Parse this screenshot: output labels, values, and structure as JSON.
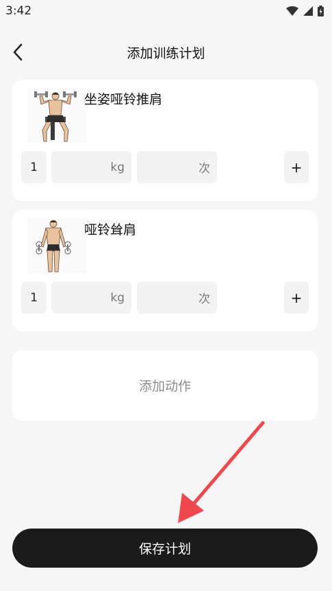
{
  "status_bar": {
    "time": "3:42",
    "icons": [
      "wifi-icon",
      "signal-icon",
      "battery-icon"
    ]
  },
  "header": {
    "title": "添加训练计划",
    "back_icon": "chevron-left-icon"
  },
  "exercises": [
    {
      "name": "坐姿哑铃推肩",
      "image": "seated-dumbbell-press-illustration",
      "set_number": "1",
      "weight_unit": "kg",
      "reps_unit": "次",
      "add_label": "+"
    },
    {
      "name": "哑铃耸肩",
      "image": "dumbbell-shrug-illustration",
      "set_number": "1",
      "weight_unit": "kg",
      "reps_unit": "次",
      "add_label": "+"
    }
  ],
  "add_exercise_label": "添加动作",
  "save_button_label": "保存计划",
  "annotation": {
    "arrow_color": "#f0474f"
  },
  "colors": {
    "background": "#f6f6f6",
    "card": "#ffffff",
    "input_bg": "#f3f3f3",
    "primary_button": "#1b1b1b"
  }
}
